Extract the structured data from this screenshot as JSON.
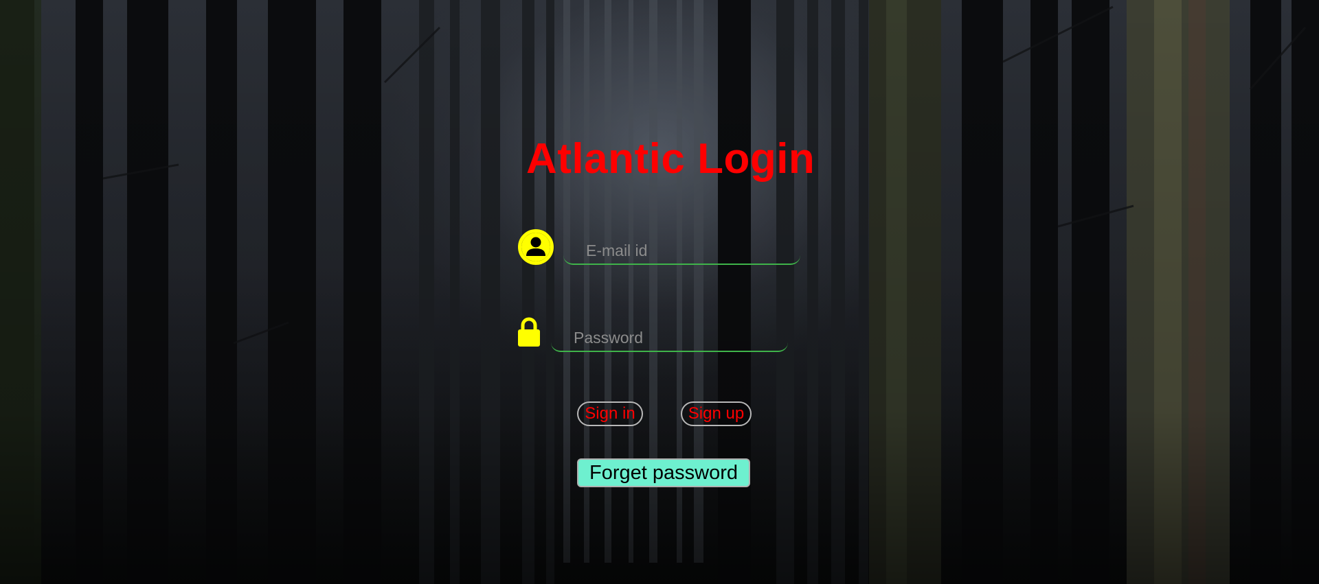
{
  "page": {
    "title": "Atlantic Login"
  },
  "form": {
    "email_placeholder": "E-mail id",
    "email_value": "",
    "password_placeholder": "Password",
    "password_value": "",
    "signin_label": "Sign in",
    "signup_label": "Sign up",
    "forget_label": "Forget password"
  },
  "icons": {
    "user": "user-circle-icon",
    "lock": "lock-icon"
  },
  "colors": {
    "title": "#ff0000",
    "icon": "#ffff00",
    "field_underline": "#3fb44a",
    "button_text": "#ff0000",
    "forget_button_bg": "#6ef0cf"
  }
}
